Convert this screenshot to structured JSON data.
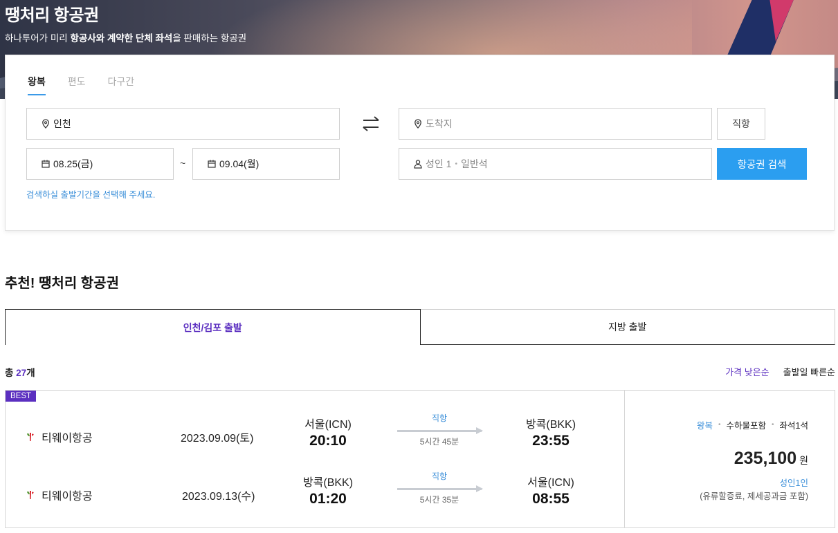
{
  "hero": {
    "title": "땡처리 항공권",
    "subtitle_pre": "하나투어가 미리 ",
    "subtitle_bold": "항공사와 계약한 단체 좌석",
    "subtitle_post": "을 판매하는 항공권"
  },
  "search": {
    "tabs": [
      "왕복",
      "편도",
      "다구간"
    ],
    "active_tab": "왕복",
    "origin": "인천",
    "destination_placeholder": "도착지",
    "depart_date": "08.25(금)",
    "tilde": "~",
    "return_date": "09.04(월)",
    "passengers": "성인 1",
    "passengers_dot": "•",
    "cabin": "일반석",
    "direct_label": "직항",
    "search_label": "항공권 검색",
    "hint": "검색하실 출발기간을 선택해 주세요."
  },
  "recommend": {
    "title": "추천! 땡처리 항공권",
    "tabs": [
      "인천/김포 출발",
      "지방 출발"
    ],
    "count_pre": "총 ",
    "count_num": "27",
    "count_post": "개",
    "sorts": [
      "가격 낮은순",
      "출발일 빠른순"
    ]
  },
  "result": {
    "badge": "BEST",
    "legs": [
      {
        "airline": "티웨이항공",
        "date": "2023.09.09(토)",
        "from_city": "서울(ICN)",
        "from_time": "20:10",
        "type": "직항",
        "duration": "5시간 45분",
        "to_city": "방콕(BKK)",
        "to_time": "23:55"
      },
      {
        "airline": "티웨이항공",
        "date": "2023.09.13(수)",
        "from_city": "방콕(BKK)",
        "from_time": "01:20",
        "type": "직항",
        "duration": "5시간 35분",
        "to_city": "서울(ICN)",
        "to_time": "08:55"
      }
    ],
    "tags": [
      "왕복",
      "수하물포함",
      "좌석1석"
    ],
    "price": "235,100",
    "currency": "원",
    "pax": "성인1인",
    "included": "(유류할증료, 제세공과금 포함)"
  },
  "colors": {
    "accent_purple": "#5b2fc0",
    "accent_blue": "#2b9ef0",
    "link_blue": "#3b8fd9",
    "airline_red": "#d8232a"
  },
  "icons": {
    "location": "map-pin-icon",
    "calendar": "calendar-icon",
    "person": "person-icon",
    "swap": "swap-arrows-icon",
    "airline_logo": "tway-logo-icon"
  }
}
